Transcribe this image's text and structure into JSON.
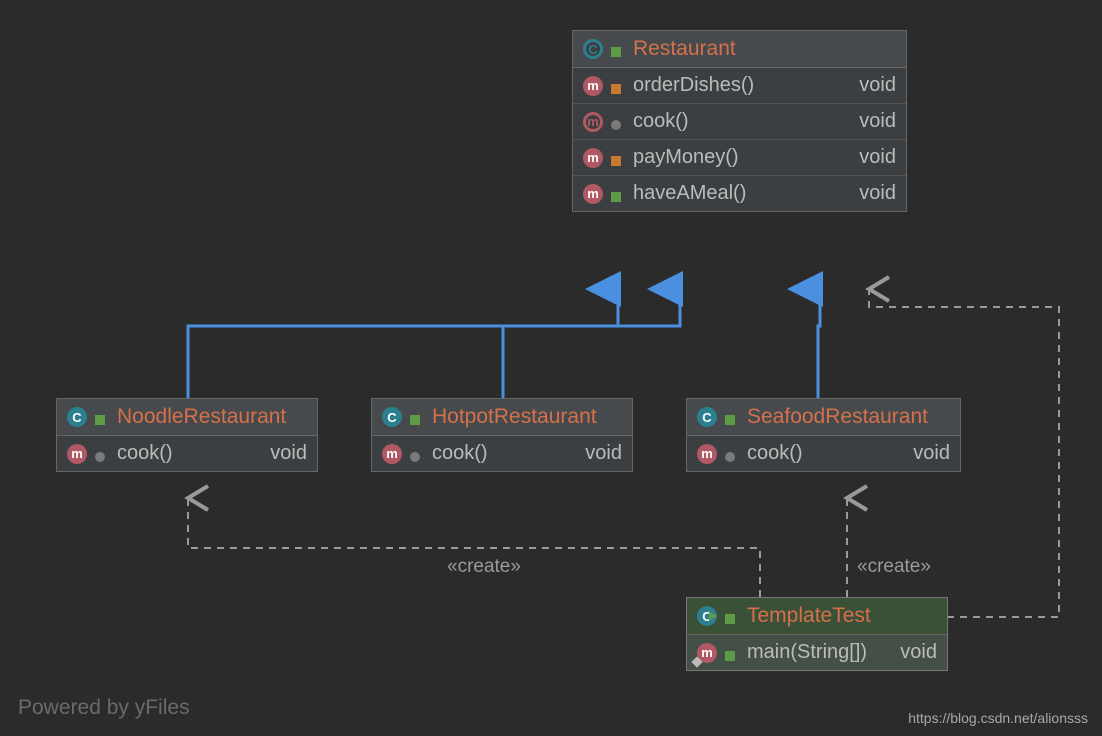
{
  "footer": {
    "poweredBy": "Powered by yFiles",
    "url": "https://blog.csdn.net/alionsss"
  },
  "labels": {
    "create1": "«create»",
    "create2": "«create»"
  },
  "classes": {
    "restaurant": {
      "name": "Restaurant",
      "methods": [
        {
          "name": "orderDishes()",
          "ret": "void",
          "vis": "lock",
          "badge": "m"
        },
        {
          "name": "cook()",
          "ret": "void",
          "vis": "key",
          "badge": "m-ring"
        },
        {
          "name": "payMoney()",
          "ret": "void",
          "vis": "lock",
          "badge": "m"
        },
        {
          "name": "haveAMeal()",
          "ret": "void",
          "vis": "unlock",
          "badge": "m"
        }
      ]
    },
    "noodle": {
      "name": "NoodleRestaurant",
      "methods": [
        {
          "name": "cook()",
          "ret": "void",
          "vis": "key",
          "badge": "m"
        }
      ]
    },
    "hotpot": {
      "name": "HotpotRestaurant",
      "methods": [
        {
          "name": "cook()",
          "ret": "void",
          "vis": "key",
          "badge": "m"
        }
      ]
    },
    "seafood": {
      "name": "SeafoodRestaurant",
      "methods": [
        {
          "name": "cook()",
          "ret": "void",
          "vis": "key",
          "badge": "m"
        }
      ]
    },
    "template": {
      "name": "TemplateTest",
      "methods": [
        {
          "name": "main(String[])",
          "ret": "void",
          "vis": "unlock",
          "badge": "m"
        }
      ]
    }
  }
}
